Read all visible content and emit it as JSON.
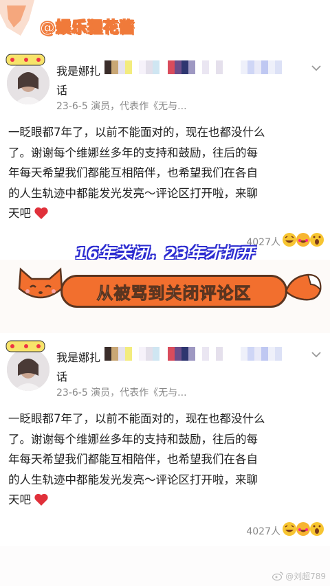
{
  "watermark": "@娱乐狸花酱",
  "headline_banner": "16年关闭，23年才打开",
  "title_pill": "从被骂到关闭评论区",
  "posts": [
    {
      "username": "我是娜扎",
      "username_cont": "话",
      "meta": "23-6-5  演员，代表作《无与...",
      "lines": [
        "一眨眼都7年了，以前不能面对的，现在也都没什么",
        "了。谢谢每个维娜丝多年的支持和鼓励，往后的每",
        "年每天希望我们都能互相陪伴，也希望我们在各自",
        "的人生轨迹中都能发光发亮～评论区打开啦，来聊",
        "天吧"
      ],
      "likes": "4027人"
    },
    {
      "username": "我是娜扎",
      "username_cont": "话",
      "meta": "23-6-5  演员，代表作《无与...",
      "lines": [
        "一眨眼都7年了，以前不能面对的，现在也都没什么",
        "了。谢谢每个维娜丝多年的支持和鼓励，往后的每",
        "年每天希望我们都能互相陪伴，也希望我们在各自",
        "的人生轨迹中都能发光发亮～评论区打开啦，来聊",
        "天吧"
      ],
      "likes": "4027人"
    }
  ],
  "weibo_watermark": "@刘超789",
  "colors": {
    "accent_orange": "#f26f2e",
    "banner_blue": "#2c2cd0",
    "heart_red": "#e0303a"
  },
  "icons": [
    "fox-ear-icon",
    "chevron-down-icon",
    "heart-emoji-icon",
    "laugh-emoji-icon",
    "fox-head-icon",
    "fox-tail-icon",
    "weibo-logo-icon"
  ]
}
